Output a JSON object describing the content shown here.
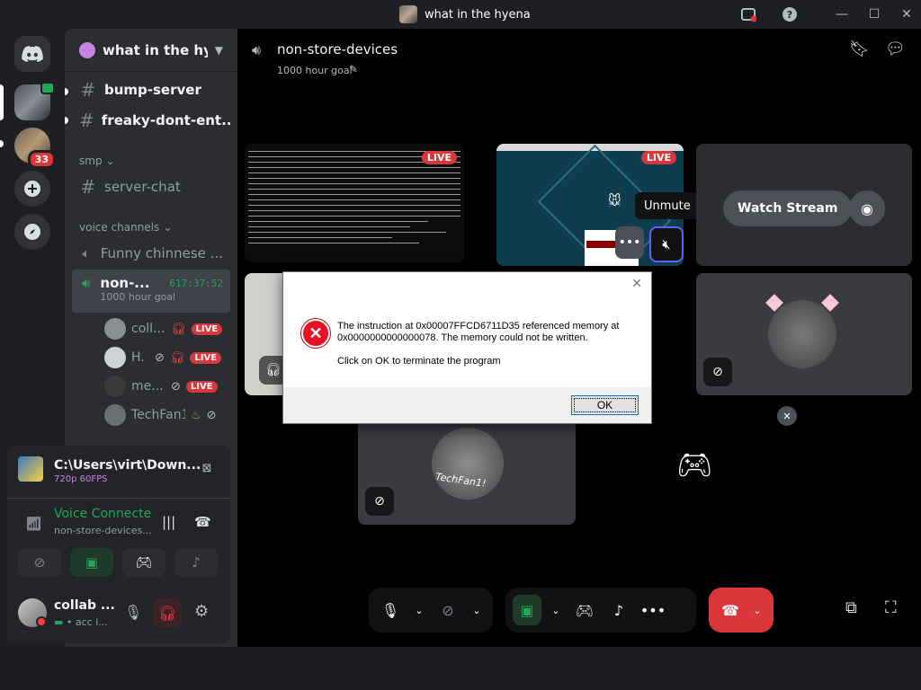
{
  "window": {
    "title": "what in the hyena"
  },
  "server": {
    "name": "what in the hy..."
  },
  "channels": [
    {
      "name": "bump-server",
      "unread": true
    },
    {
      "name": "freaky-dont-ent...",
      "unread": true
    }
  ],
  "categories": {
    "smp": "smp",
    "voice": "voice channels"
  },
  "smp_channels": [
    {
      "name": "server-chat"
    }
  ],
  "voice_channels": [
    {
      "name": "Funny chinnese ..."
    },
    {
      "name": "non-...",
      "timer": "617:37:52",
      "status": "1000 hour goal"
    }
  ],
  "voice_users": [
    {
      "name": "coll...",
      "live": "LIVE"
    },
    {
      "name": "H.",
      "live": "LIVE"
    },
    {
      "name": "me...",
      "live": "LIVE"
    },
    {
      "name": "TechFan1!",
      "live": ""
    }
  ],
  "server_badges": {
    "mentions": "33"
  },
  "stream_panel": {
    "title": "C:\\Users\\virt\\Down...",
    "quality": "720p 60FPS",
    "voice_status": "Voice Connecte",
    "voice_channel": "non-store-devices..."
  },
  "user_panel": {
    "name": "collab ...",
    "status": "acc i..."
  },
  "main": {
    "channel_name": "non-store-devices",
    "channel_status": "1000 hour goal",
    "live_label": "LIVE",
    "unmute_tooltip": "Unmute",
    "watch_stream": "Watch Stream",
    "techfan_label": "TechFan1!"
  },
  "dialog": {
    "message_line1": "The instruction at 0x00007FFCD6711D35 referenced memory at",
    "message_line2": "0x0000000000000078. The memory could not be written.",
    "message_line3": "Click on OK to terminate the program",
    "ok_label": "OK"
  },
  "colors": {
    "accent_green": "#23a55a",
    "live_red": "#da373c",
    "background": "#000000"
  }
}
